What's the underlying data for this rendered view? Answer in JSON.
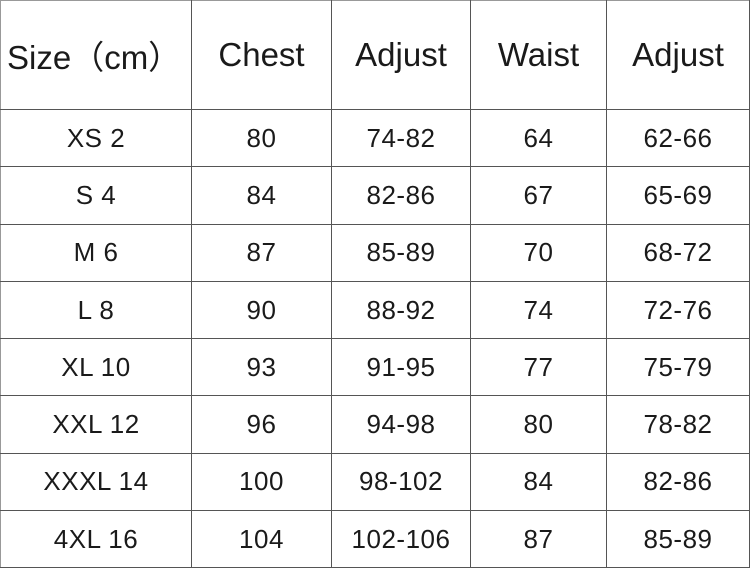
{
  "table": {
    "headers": [
      "Size（cm）",
      "Chest",
      "Adjust",
      "Waist",
      "Adjust"
    ],
    "rows": [
      [
        "XS 2",
        "80",
        "74-82",
        "64",
        "62-66"
      ],
      [
        "S 4",
        "84",
        "82-86",
        "67",
        "65-69"
      ],
      [
        "M 6",
        "87",
        "85-89",
        "70",
        "68-72"
      ],
      [
        "L 8",
        "90",
        "88-92",
        "74",
        "72-76"
      ],
      [
        "XL 10",
        "93",
        "91-95",
        "77",
        "75-79"
      ],
      [
        "XXL 12",
        "96",
        "94-98",
        "80",
        "78-82"
      ],
      [
        "XXXL 14",
        "100",
        "98-102",
        "84",
        "82-86"
      ],
      [
        "4XL 16",
        "104",
        "102-106",
        "87",
        "85-89"
      ]
    ]
  }
}
